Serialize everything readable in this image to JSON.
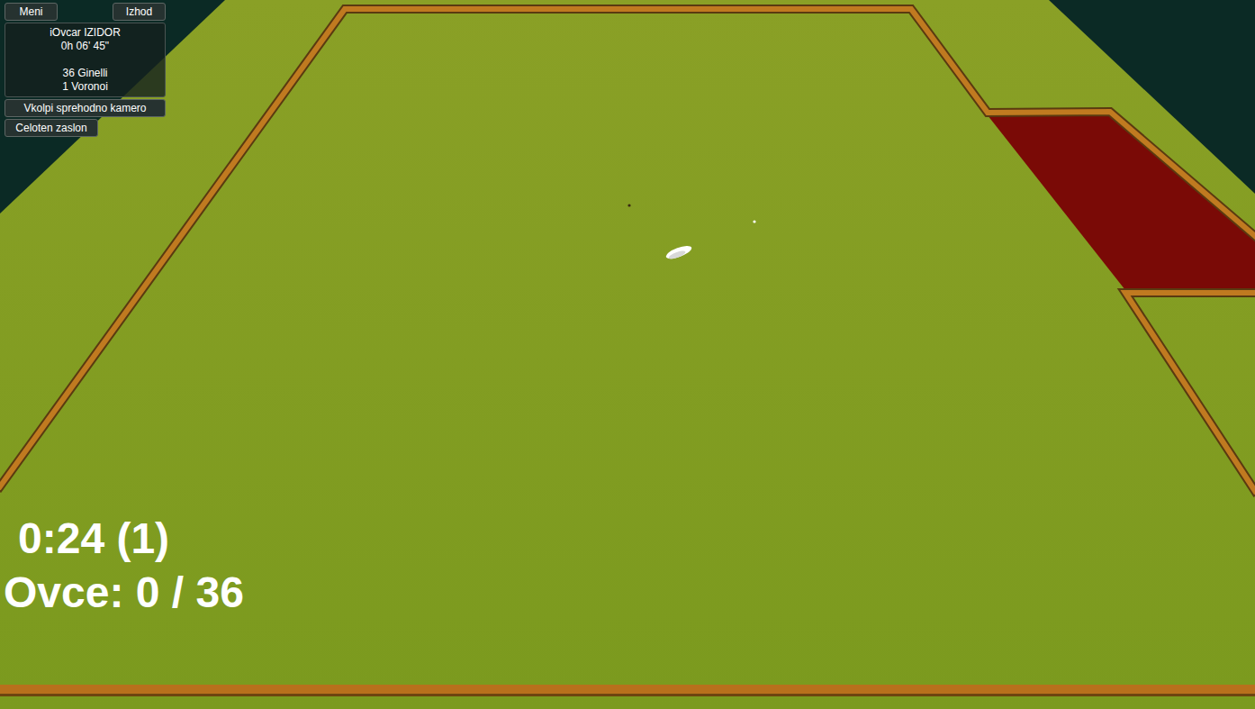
{
  "toolbar": {
    "buttons": [
      "Meni",
      "Izhod"
    ]
  },
  "info_panel": {
    "lines": [
      "iOvcar IZIDOR",
      "0h 06' 45\"",
      "",
      "36 Ginelli",
      "1 Voronoi"
    ]
  },
  "camera_button": "Vkolpi sprehodno kamero",
  "fullscreen_button": "Celoten zaslon",
  "overlay": {
    "timer": "0:24 (1)",
    "sheep_count": "Ovce: 0 / 36"
  }
}
